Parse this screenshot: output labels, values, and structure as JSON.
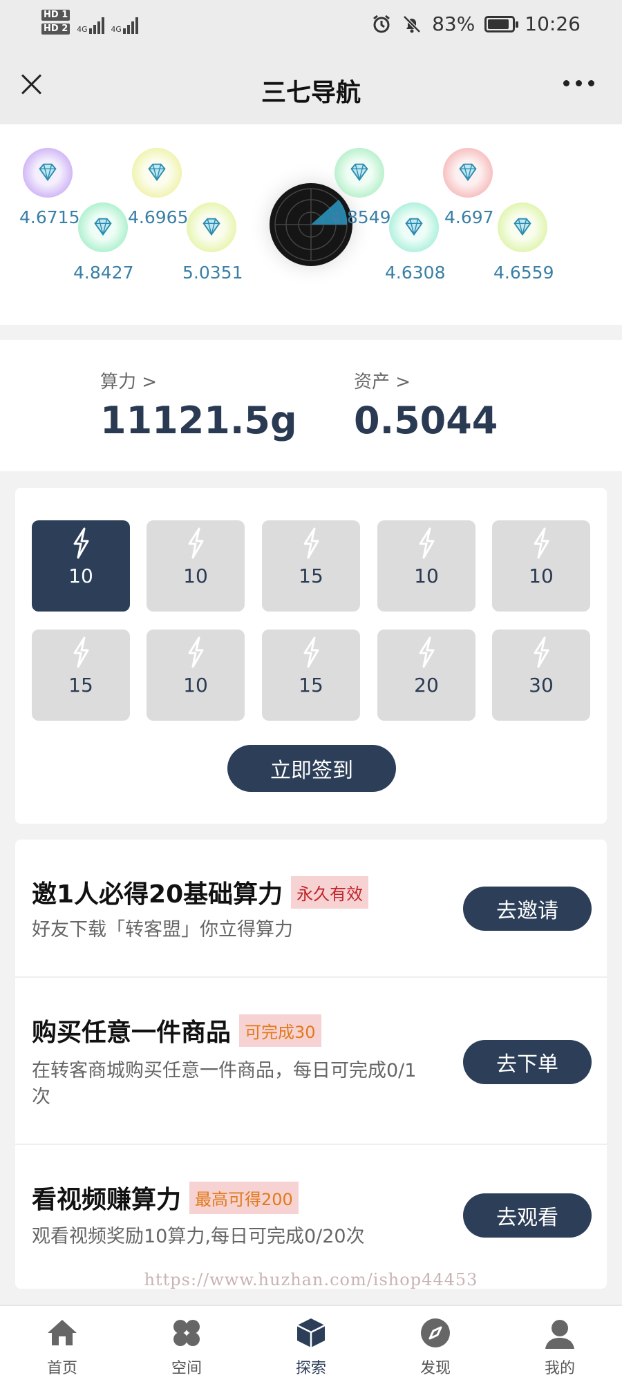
{
  "status_bar": {
    "hd_labels": [
      "HD 1",
      "HD 2"
    ],
    "network": [
      "4G",
      "4G"
    ],
    "battery": "83%",
    "time": "10:26",
    "icons": [
      "alarm-icon",
      "mute-bell-icon",
      "battery-icon"
    ]
  },
  "header": {
    "title": "三七导航",
    "icons": [
      "close-icon",
      "more-icon"
    ]
  },
  "gems": [
    {
      "value": "4.6715",
      "color": "#b58cf0"
    },
    {
      "value": "4.8427",
      "color": "#7fe7b3"
    },
    {
      "value": "4.6965",
      "color": "#e7ec7f"
    },
    {
      "value": "5.0351",
      "color": "#d9ef7f"
    },
    {
      "value": "4.8549",
      "color": "#8fe7ae"
    },
    {
      "value": "4.6308",
      "color": "#7fe7c7"
    },
    {
      "value": "4.697",
      "color": "#f29a9a"
    },
    {
      "value": "4.6559",
      "color": "#cdef7f"
    }
  ],
  "stats": {
    "power_label": "算力 >",
    "power_value": "11121.5g",
    "asset_label": "资产 >",
    "asset_value": "0.5044"
  },
  "checkin": {
    "days": [
      "10",
      "10",
      "15",
      "10",
      "10",
      "15",
      "10",
      "15",
      "20",
      "30"
    ],
    "active_index": 0,
    "button": "立即签到"
  },
  "tasks": [
    {
      "title": "邀1人必得20基础算力",
      "badge": "永久有效",
      "desc": "好友下载「转客盟」你立得算力",
      "button": "去邀请"
    },
    {
      "title": "购买任意一件商品",
      "badge": "可完成30",
      "desc": "在转客商城购买任意一件商品，每日可完成0/1次",
      "button": "去下单"
    },
    {
      "title": "看视频赚算力",
      "badge": "最高可得200",
      "desc": "观看视频奖励10算力,每日可完成0/20次",
      "button": "去观看"
    }
  ],
  "watermark": "https://www.huzhan.com/ishop44453",
  "tabbar": [
    {
      "label": "首页",
      "icon": "home-icon"
    },
    {
      "label": "空间",
      "icon": "clover-icon"
    },
    {
      "label": "探索",
      "icon": "cube-icon"
    },
    {
      "label": "发现",
      "icon": "compass-icon"
    },
    {
      "label": "我的",
      "icon": "user-icon"
    }
  ],
  "accent_color": "#2c3e58"
}
